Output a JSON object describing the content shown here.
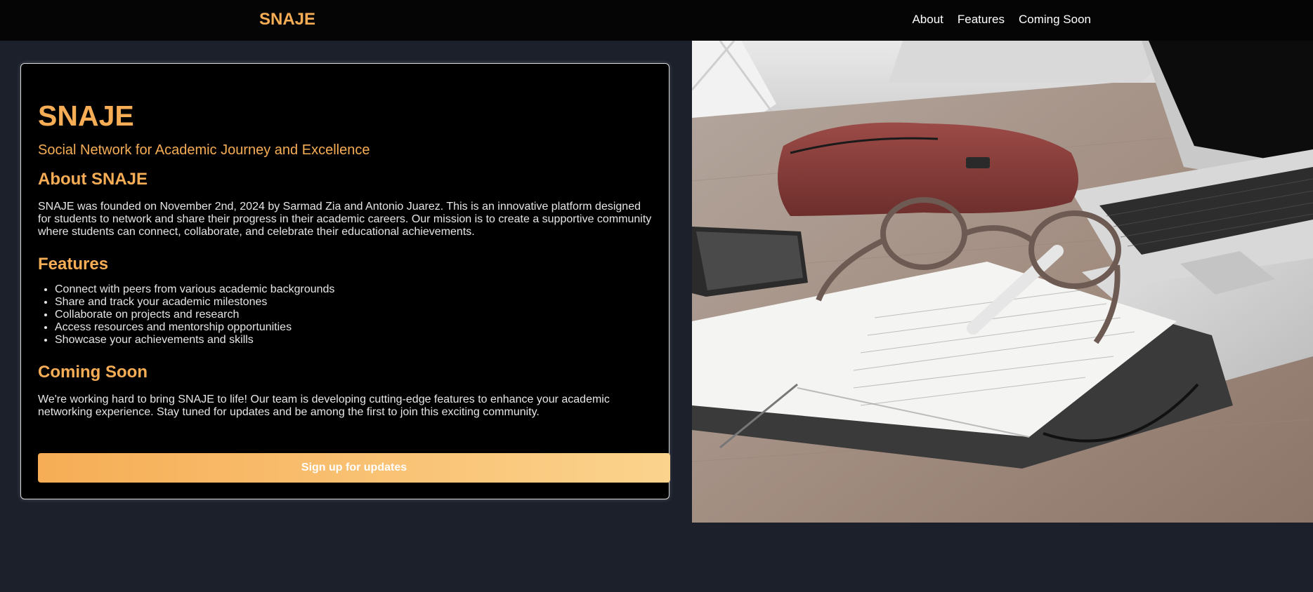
{
  "header": {
    "brand": "SNAJE",
    "nav": [
      "About",
      "Features",
      "Coming Soon"
    ]
  },
  "card": {
    "title": "SNAJE",
    "tagline": "Social Network for Academic Journey and Excellence",
    "about": {
      "heading": "About SNAJE",
      "text": "SNAJE was founded on November 2nd, 2024 by Sarmad Zia and Antonio Juarez. This is an innovative platform designed for students to network and share their progress in their academic careers. Our mission is to create a supportive community where students can connect, collaborate, and celebrate their educational achievements."
    },
    "features": {
      "heading": "Features",
      "items": [
        "Connect with peers from various academic backgrounds",
        "Share and track your academic milestones",
        "Collaborate on projects and research",
        "Access resources and mentorship opportunities",
        "Showcase your achievements and skills"
      ]
    },
    "coming_soon": {
      "heading": "Coming Soon",
      "text": "We're working hard to bring SNAJE to life! Our team is developing cutting-edge features to enhance your academic networking experience. Stay tuned for updates and be among the first to join this exciting community."
    },
    "cta_label": "Sign up for updates"
  },
  "colors": {
    "accent": "#f6ad55",
    "accent_light": "#fbd38d",
    "page_bg": "#1b202b",
    "topbar_bg": "#050505"
  }
}
